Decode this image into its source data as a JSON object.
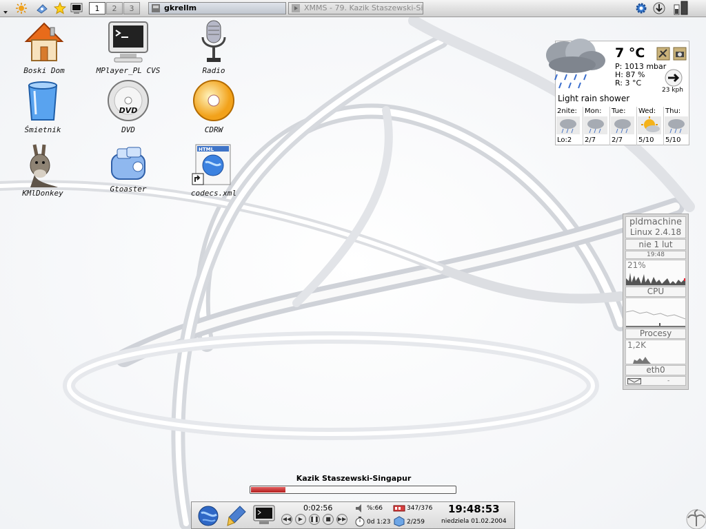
{
  "taskbar": {
    "desktops": [
      "1",
      "2",
      "3"
    ],
    "active_desktop": "1",
    "tasks": [
      {
        "label": "gkrellm",
        "state": "active"
      },
      {
        "label": "XMMS - 79. Kazik Staszewski-Si",
        "state": "inactive"
      }
    ],
    "launcher_icons": [
      "kde-menu-icon",
      "file-manager-icon",
      "favorites-star-icon",
      "terminal-icon"
    ],
    "tray_icons": [
      "settings-gear-icon",
      "download-icon",
      "battery-icon"
    ]
  },
  "desktop_icons": [
    {
      "label": "Boski Dom",
      "icon": "home-icon"
    },
    {
      "label": "MPlayer_PL CVS",
      "icon": "terminal-monitor-icon"
    },
    {
      "label": "Radio",
      "icon": "microphone-icon"
    },
    {
      "label": "Śmietnik",
      "icon": "trash-icon"
    },
    {
      "label": "DVD",
      "icon": "dvd-icon"
    },
    {
      "label": "CDRW",
      "icon": "cdrw-icon"
    },
    {
      "label": "KMlDonkey",
      "icon": "donkey-icon"
    },
    {
      "label": "Gtoaster",
      "icon": "gtoaster-icon"
    },
    {
      "label": "codecs.xml",
      "icon": "html-file-icon"
    }
  ],
  "weather": {
    "temperature": "7 °C",
    "pressure": "P: 1013 mbar",
    "humidity": "H: 87 %",
    "real_feel": "R: 3 °C",
    "wind": "23 kph",
    "condition": "Light rain shower",
    "forecast": [
      {
        "day": "2nite:",
        "range": "Lo:2",
        "icon": "rain-icon"
      },
      {
        "day": "Mon:",
        "range": "2/7",
        "icon": "rain-icon"
      },
      {
        "day": "Tue:",
        "range": "2/7",
        "icon": "rain-icon"
      },
      {
        "day": "Wed:",
        "range": "5/10",
        "icon": "sun-cloud-icon"
      },
      {
        "day": "Thu:",
        "range": "5/10",
        "icon": "rain-icon"
      }
    ]
  },
  "gkrellm": {
    "hostname": "pldmachine",
    "kernel": "Linux 2.4.18",
    "date": "nie 1 lut",
    "time": "19:48",
    "cpu_percent": "21%",
    "cpu_label": "CPU",
    "proc_label": "Procesy",
    "proc_value": "1,2K",
    "net_label": "eth0",
    "net_value": "-"
  },
  "xmms": {
    "song_title": "Kazik Staszewski-Singapur",
    "progress": 0.17,
    "elapsed": "0:02:56"
  },
  "bottom_panel": {
    "volume": "%:66",
    "stopwatch": "0d 1:23",
    "memory": "347/376",
    "packages": "2/259",
    "clock": "19:48:53",
    "date": "niedziela  01.02.2004",
    "control_glyphs": [
      "◀◀",
      "▶",
      "❚❚",
      "■",
      "▶▶"
    ]
  }
}
